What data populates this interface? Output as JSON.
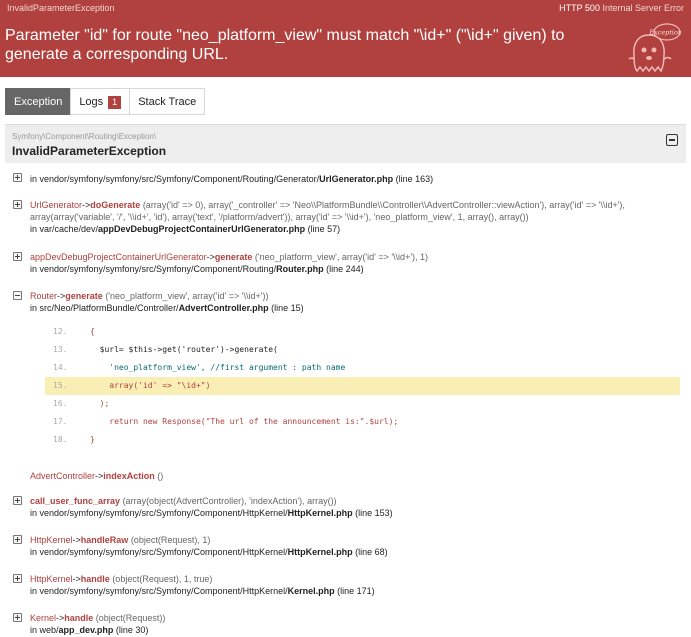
{
  "topbar": {
    "title": "InvalidParameterException",
    "status_code": "HTTP 500",
    "status_text": "Internal Server Error"
  },
  "header": {
    "message": "Parameter \"id\" for route \"neo_platform_view\" must match \"\\id+\" (\"\\id+\" given) to generate a corresponding URL.",
    "mascot_text": "Exception!"
  },
  "tabs": [
    {
      "label": "Exception"
    },
    {
      "label": "Logs",
      "badge": "1"
    },
    {
      "label": "Stack Trace"
    }
  ],
  "exception": {
    "namespace": "Symfony\\Component\\Routing\\Exception\\",
    "class": "InvalidParameterException"
  },
  "trace": {
    "t0_loc_pre": "in vendor/symfony/symfony/src/Symfony/Component/Routing/Generator/",
    "t0_file": "UrlGenerator.php",
    "t0_line": " (line 163)",
    "t1_class": "UrlGenerator",
    "t1_arrow": "->",
    "t1_fn": "doGenerate",
    "t1_args1": " (array('id' => 0), array('_controller' => 'Neo\\\\PlatformBundle\\\\Controller\\\\AdvertController::viewAction'), array('id' => '\\\\id+'),",
    "t1_args2": "array(array('variable', '/', '\\\\id+', 'id'), array('text', '/platform/advert')), array('id' => '\\\\id+'), 'neo_platform_view', 1, array(), array())",
    "t1_loc_pre": "in var/cache/dev/",
    "t1_file": "appDevDebugProjectContainerUrlGenerator.php",
    "t1_line": " (line 57)",
    "t2_class": "appDevDebugProjectContainerUrlGenerator",
    "t2_arrow": "->",
    "t2_fn": "generate",
    "t2_args": " ('neo_platform_view', array('id' => '\\\\id+'), 1)",
    "t2_loc_pre": "in vendor/symfony/symfony/src/Symfony/Component/Routing/",
    "t2_file": "Router.php",
    "t2_line": " (line 244)",
    "t3_class": "Router",
    "t3_arrow": "->",
    "t3_fn": "generate",
    "t3_args": " ('neo_platform_view', array('id' => '\\\\id+'))",
    "t3_loc_pre": "in src/Neo/PlatformBundle/Controller/",
    "t3_file": "AdvertController.php",
    "t3_line": " (line 15)",
    "t4_class": "AdvertController",
    "t4_arrow": "->",
    "t4_fn": "indexAction",
    "t4_args": " ()",
    "t5_fn": "call_user_func_array",
    "t5_args": " (array(object(AdvertController), 'indexAction'), array())",
    "t5_loc_pre": "in vendor/symfony/symfony/src/Symfony/Component/HttpKernel/",
    "t5_file": "HttpKernel.php",
    "t5_line": " (line 153)",
    "t6_class": "HttpKernel",
    "t6_arrow": "->",
    "t6_fn": "handleRaw",
    "t6_args": " (object(Request), 1)",
    "t6_loc_pre": "in vendor/symfony/symfony/src/Symfony/Component/HttpKernel/",
    "t6_file": "HttpKernel.php",
    "t6_line": " (line 68)",
    "t7_class": "HttpKernel",
    "t7_arrow": "->",
    "t7_fn": "handle",
    "t7_args": " (object(Request), 1, true)",
    "t7_loc_pre": "in vendor/symfony/symfony/src/Symfony/Component/HttpKernel/",
    "t7_file": "Kernel.php",
    "t7_line": " (line 171)",
    "t8_class": "Kernel",
    "t8_arrow": "->",
    "t8_fn": "handle",
    "t8_args": " (object(Request))",
    "t8_loc_pre": "in web/",
    "t8_file": "app_dev.php",
    "t8_line": " (line 30)"
  },
  "code": [
    {
      "n": "12.",
      "t": "{"
    },
    {
      "n": "13.",
      "t": "  $url= $this->get('router')->generate("
    },
    {
      "n": "14.",
      "t": "    'neo_platform_view', //first argument : path name"
    },
    {
      "n": "15.",
      "t": "    array('id' => \"\\id+\")"
    },
    {
      "n": "16.",
      "t": "  );"
    },
    {
      "n": "17.",
      "t": "    return new Response(\"The url of the announcement is:\".$url);"
    },
    {
      "n": "18.",
      "t": "}"
    }
  ],
  "colors": {
    "brand_red": "#b0413e",
    "highlight": "#f9eeb3"
  }
}
